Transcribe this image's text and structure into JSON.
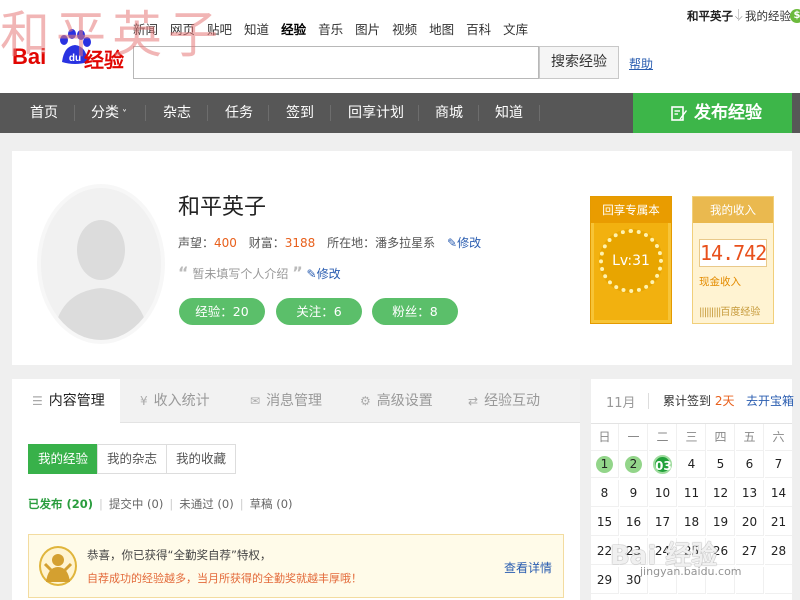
{
  "watermark": {
    "text": "和平英子",
    "bottom_text": "Bai 经验",
    "bottom_url": "jingyan.baidu.com"
  },
  "brand": {
    "bai": "Bai",
    "du": "du",
    "jingyan": "经验",
    "color": "#e10602"
  },
  "top_nav": [
    {
      "label": "新闻"
    },
    {
      "label": "网页"
    },
    {
      "label": "贴吧"
    },
    {
      "label": "知道"
    },
    {
      "label": "经验",
      "active": true
    },
    {
      "label": "音乐"
    },
    {
      "label": "图片"
    },
    {
      "label": "视频"
    },
    {
      "label": "地图"
    },
    {
      "label": "百科"
    },
    {
      "label": "文库"
    }
  ],
  "search": {
    "placeholder": "",
    "button_label": "搜索经验",
    "help_label": "帮助"
  },
  "user_menu": {
    "username": "和平英子",
    "my_experience": "我的经验"
  },
  "main_nav": {
    "items": [
      {
        "label": "首页"
      },
      {
        "label": "分类"
      },
      {
        "label": "杂志"
      },
      {
        "label": "任务"
      },
      {
        "label": "签到"
      },
      {
        "label": "回享计划"
      },
      {
        "label": "商城"
      },
      {
        "label": "知道"
      }
    ],
    "publish_label": "发布经验",
    "publish_color": "#3db649"
  },
  "profile": {
    "name": "和平英子",
    "reputation_label": "声望：",
    "reputation_value": "400",
    "wealth_label": "财富：",
    "wealth_value": "3188",
    "location_label": "所在地：",
    "location_value": "潘多拉星系",
    "edit_label": "修改",
    "intro_placeholder": "暂未填写个人介绍",
    "intro_edit_label": "修改",
    "pills": [
      {
        "label": "经验：20"
      },
      {
        "label": "关注：6"
      },
      {
        "label": "粉丝：8"
      }
    ]
  },
  "badges": {
    "level_title": "回享专属本",
    "level_value": "Lv:31",
    "income_title": "我的收入",
    "income_amount": "14.742",
    "income_caption": "现金收入",
    "income_footer": "百度经验"
  },
  "content_tabs": [
    {
      "label": "内容管理",
      "icon": "list-icon",
      "active": true
    },
    {
      "label": "收入统计",
      "icon": "yen-icon"
    },
    {
      "label": "消息管理",
      "icon": "mail-icon"
    },
    {
      "label": "高级设置",
      "icon": "gear-icon"
    },
    {
      "label": "经验互动",
      "icon": "swap-icon"
    }
  ],
  "sub_tabs": [
    {
      "label": "我的经验",
      "active": true
    },
    {
      "label": "我的杂志"
    },
    {
      "label": "我的收藏"
    }
  ],
  "filters": {
    "published": "已发布 (20)",
    "submitting": "提交中 (0)",
    "rejected": "未通过 (0)",
    "draft": "草稿 (0)"
  },
  "notice": {
    "line1": "恭喜，你已获得“全勤奖自荐”特权，",
    "line2": "自荐成功的经验越多，当月所获得的全勤奖就越丰厚哦！",
    "more_label": "查看详情"
  },
  "calendar": {
    "month": "11月",
    "signed_label": "累计签到",
    "signed_days": "2天",
    "open_label": "去开宝箱",
    "weekdays": [
      "日",
      "一",
      "二",
      "三",
      "四",
      "五",
      "六"
    ],
    "rows": [
      [
        "1",
        "2",
        "03",
        "4",
        "5",
        "6",
        "7"
      ],
      [
        "8",
        "9",
        "10",
        "11",
        "12",
        "13",
        "14"
      ],
      [
        "15",
        "16",
        "17",
        "18",
        "19",
        "20",
        "21"
      ],
      [
        "22",
        "23",
        "24",
        "25",
        "26",
        "27",
        "28"
      ],
      [
        "29",
        "30",
        "",
        "",
        "",
        "",
        ""
      ]
    ],
    "signed_dates": [
      "1",
      "2"
    ],
    "today": "03"
  }
}
